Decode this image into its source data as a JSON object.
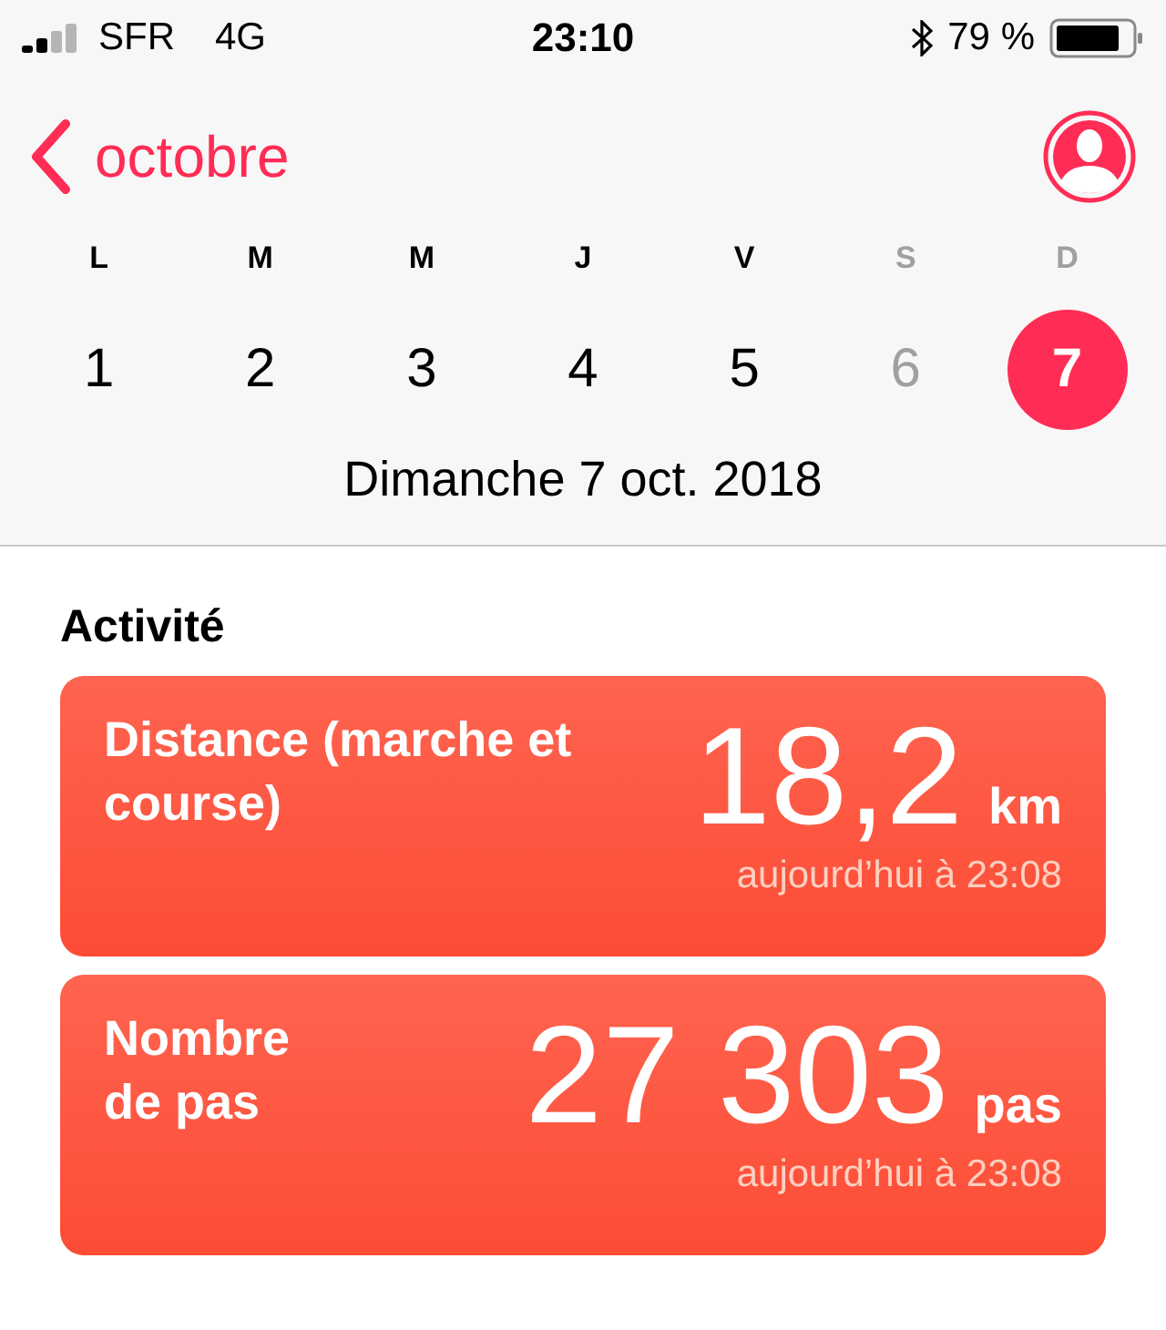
{
  "status_bar": {
    "carrier": "SFR",
    "network": "4G",
    "time": "23:10",
    "battery": "79 %"
  },
  "nav": {
    "back": "octobre"
  },
  "week": [
    {
      "letter": "L",
      "number": "1",
      "weekend": false,
      "selected": false
    },
    {
      "letter": "M",
      "number": "2",
      "weekend": false,
      "selected": false
    },
    {
      "letter": "M",
      "number": "3",
      "weekend": false,
      "selected": false
    },
    {
      "letter": "J",
      "number": "4",
      "weekend": false,
      "selected": false
    },
    {
      "letter": "V",
      "number": "5",
      "weekend": false,
      "selected": false
    },
    {
      "letter": "S",
      "number": "6",
      "weekend": true,
      "selected": false
    },
    {
      "letter": "D",
      "number": "7",
      "weekend": true,
      "selected": true
    }
  ],
  "date_title": "Dimanche 7 oct. 2018",
  "section_title": "Activité",
  "cards": [
    {
      "label": "Distance (marche et course)",
      "value": "18,2",
      "unit": "km",
      "time": "aujourd’hui à 23:08"
    },
    {
      "label": "Nombre de pas",
      "value": "27 303",
      "unit": "pas",
      "time": "aujourd’hui à 23:08"
    }
  ]
}
